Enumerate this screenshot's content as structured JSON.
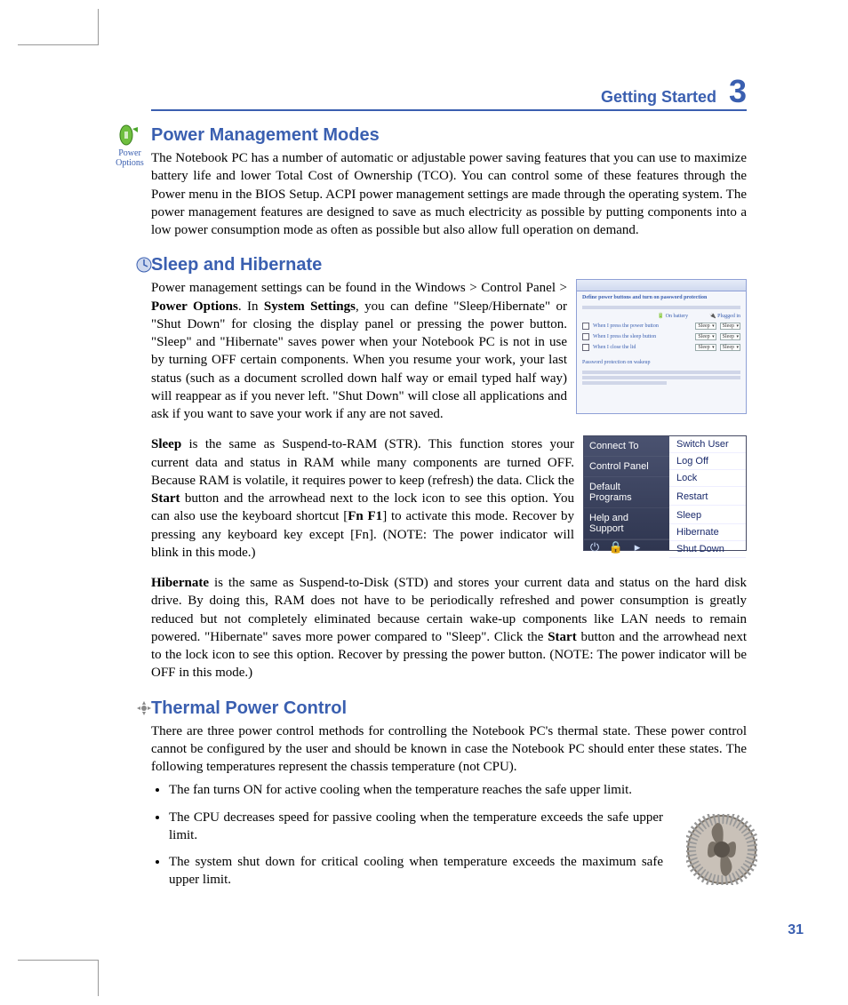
{
  "header": {
    "section_name": "Getting Started",
    "chapter_number": "3",
    "page_number": "31"
  },
  "power_mgmt": {
    "title": "Power Management Modes",
    "icon_label": "Power Options",
    "body": "The Notebook PC has a number of automatic or adjustable power saving features that you can use to maximize battery life and lower Total Cost of Ownership (TCO). You can control some of these features through the Power menu in the BIOS Setup. ACPI power management settings are made through the operating system. The power management features are designed to save as much electricity as possible by putting components into a low power consumption mode as often as possible but also allow full operation on demand."
  },
  "sleep_hibernate": {
    "title": "Sleep and Hibernate",
    "p1_a": "Power management settings can be found in the Windows > Control Panel > ",
    "p1_bold1": "Power Options",
    "p1_b": ". In ",
    "p1_bold2": "System Settings",
    "p1_c": ", you can define \"Sleep/Hibernate\" or \"Shut Down\" for closing the display panel or pressing the power button. \"Sleep\" and \"Hibernate\" saves power when your Notebook PC is not in use by turning OFF certain components. When you resume your work, your last status (such as a document scrolled down half way or email typed half way) will reappear as if you never left. \"Shut Down\" will close all applications and ask if you want to save your work if any are not saved.",
    "p2_bold1": "Sleep",
    "p2_a": " is the same as Suspend-to-RAM (STR). This function stores your current data and status in RAM while many components are turned OFF. Because RAM is volatile, it requires power to keep (refresh) the data. Click the ",
    "p2_bold2": "Start",
    "p2_b": " button and the arrowhead next to the lock icon to see this option. You can also use the keyboard shortcut [",
    "p2_bold3": "Fn F1",
    "p2_c": "] to activate this mode. Recover by pressing any keyboard key except [Fn]. (NOTE: The power indicator will blink in this mode.)",
    "p3_bold1": "Hibernate",
    "p3_a": " is the same as  Suspend-to-Disk (STD) and stores your current data and status on the hard disk drive. By doing this, RAM does not have to be periodically refreshed and power consumption is greatly reduced but not completely eliminated because certain wake-up components like LAN needs to remain powered. \"Hibernate\" saves more power compared to \"Sleep\". Click the ",
    "p3_bold2": "Start",
    "p3_b": " button and the arrowhead next to the lock icon to see this option. Recover by pressing the power button. (NOTE: The power indicator will be OFF in this mode.)"
  },
  "screenshot": {
    "heading": "Define power buttons and turn on password protection",
    "on_battery": "On battery",
    "plugged_in": "Plugged in",
    "rows": [
      {
        "label": "When I press the power button",
        "val": "Sleep"
      },
      {
        "label": "When I press the sleep button",
        "val": "Sleep"
      },
      {
        "label": "When I close the lid",
        "val": "Sleep"
      }
    ],
    "pwd_heading": "Password protection on wakeup"
  },
  "startmenu": {
    "left": [
      "Connect To",
      "Control Panel",
      "Default Programs",
      "Help and Support"
    ],
    "right": [
      "Switch User",
      "Log Off",
      "Lock",
      "Restart",
      "Sleep",
      "Hibernate",
      "Shut Down"
    ]
  },
  "thermal": {
    "title": "Thermal Power Control",
    "intro": "There are three power control methods for controlling the Notebook PC's thermal state. These power control cannot be configured by the user and should be known in case the Notebook PC should enter these states. The following temperatures represent the chassis temperature (not CPU).",
    "bullets": [
      "The fan turns ON for active cooling when the temperature reaches the safe upper limit.",
      "The CPU decreases speed for passive cooling when the temperature exceeds the safe upper limit.",
      "The system shut down for critical cooling when temperature exceeds the maximum safe upper limit."
    ]
  }
}
